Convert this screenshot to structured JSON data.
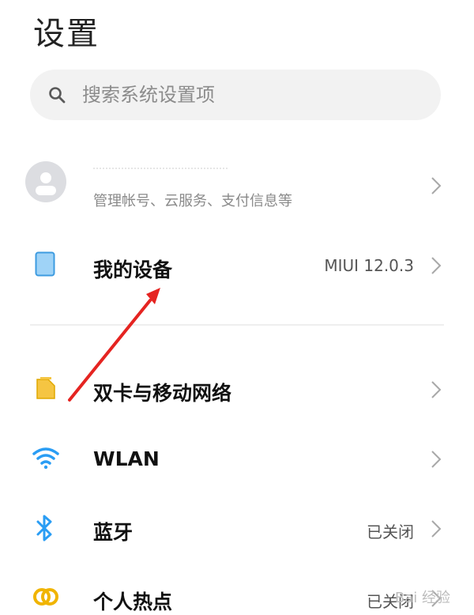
{
  "header": {
    "title": "设置"
  },
  "search": {
    "placeholder": "搜索系统设置项"
  },
  "account": {
    "subtitle": "管理帐号、云服务、支付信息等"
  },
  "device": {
    "label": "我的设备",
    "value": "MIUI 12.0.3"
  },
  "settings": [
    {
      "label": "双卡与移动网络",
      "value": ""
    },
    {
      "label": "WLAN",
      "value": ""
    },
    {
      "label": "蓝牙",
      "value": "已关闭"
    },
    {
      "label": "个人热点",
      "value": "已关闭"
    }
  ],
  "watermark": {
    "text": "Bai 经验"
  },
  "colors": {
    "accent_blue": "#2a9df4",
    "sim_yellow": "#f5c542",
    "hotspot_yellow": "#f0b400",
    "device_blue": "#7cc4f4",
    "arrow_red": "#e52421"
  }
}
